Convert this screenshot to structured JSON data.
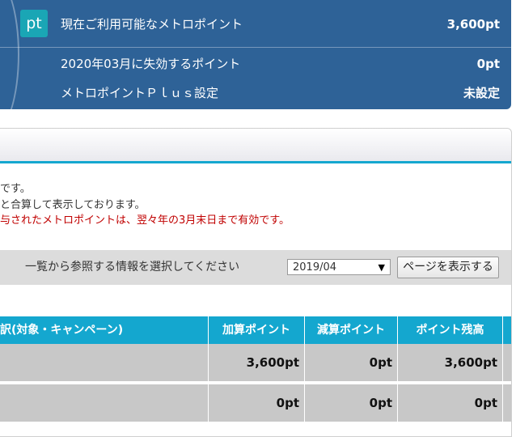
{
  "summary": {
    "badge": "pt",
    "rows": [
      {
        "label": "現在ご利用可能なメトロポイント",
        "value": "3,600pt"
      },
      {
        "label": "2020年03月に失効するポイント",
        "value": "0pt"
      },
      {
        "label": "メトロポイントＰｌｕｓ設定",
        "value": "未設定"
      }
    ]
  },
  "notes": {
    "line1": "です。",
    "line2": "と合算して表示しております。",
    "line3": "与されたメトロポイントは、翌々年の3月末日まで有効です。"
  },
  "filter": {
    "label": "一覧から参照する情報を選択してください",
    "selected": "2019/04",
    "button": "ページを表示する"
  },
  "table": {
    "headers": [
      "訳(対象・キャンペーン)",
      "加算ポイント",
      "減算ポイント",
      "ポイント残高"
    ],
    "rows": [
      [
        "",
        "3,600pt",
        "0pt",
        "3,600pt"
      ],
      [
        "",
        "0pt",
        "0pt",
        "0pt"
      ]
    ]
  },
  "colors": {
    "panel": "#2e6297",
    "accent": "#14a7cf",
    "badge": "#1aa6b5",
    "warning": "#c00000"
  }
}
